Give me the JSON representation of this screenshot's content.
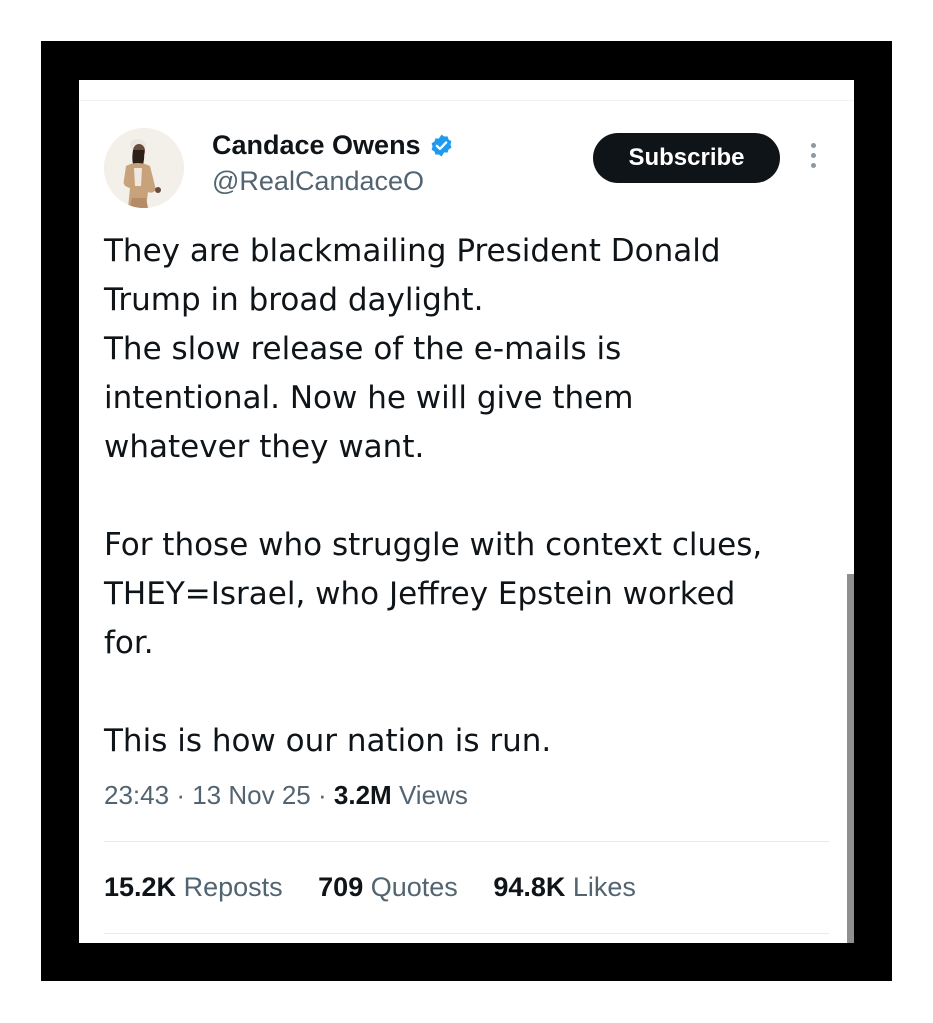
{
  "tweet": {
    "author_name": "Candace Owens",
    "handle": "@RealCandaceO",
    "subscribe_label": "Subscribe",
    "paragraphs": [
      [
        "They are blackmailing President Donald",
        "Trump in broad daylight.",
        "The slow release of the e-mails is",
        "intentional. Now he will give them",
        "whatever they want."
      ],
      [
        "For those who struggle with context clues,",
        "THEY=Israel, who Jeffrey Epstein worked",
        "for."
      ],
      [
        "This is how our nation is run."
      ]
    ],
    "time": "23:43",
    "date": "13 Nov 25",
    "separator": "·",
    "views_count": "3.2M",
    "views_label": "Views",
    "stats": [
      {
        "count": "15.2K",
        "label": "Reposts"
      },
      {
        "count": "709",
        "label": "Quotes"
      },
      {
        "count": "94.8K",
        "label": "Likes"
      }
    ]
  },
  "icons": {
    "verified": "verified-badge-icon",
    "more": "more-vertical-icon"
  },
  "colors": {
    "frame": "#000000",
    "text": "#0f1419",
    "secondary_text": "#536471",
    "verified_blue": "#1d9bf0",
    "button_bg": "#0f1419"
  }
}
